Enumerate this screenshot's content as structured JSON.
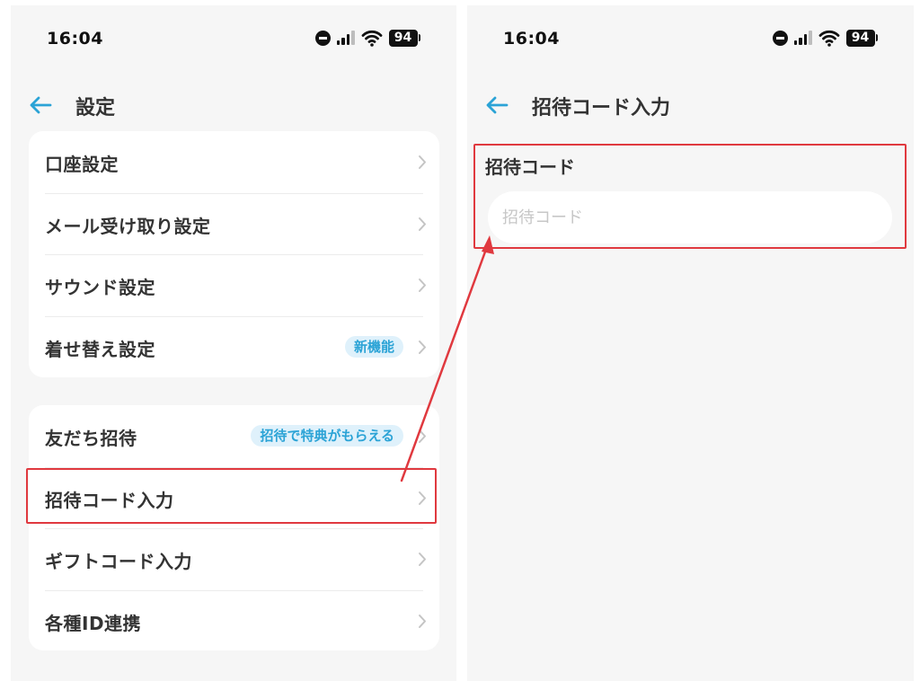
{
  "left_screen": {
    "status_bar": {
      "time": "16:04",
      "battery": "94"
    },
    "header": {
      "title": "設定"
    },
    "settings_group_1": [
      {
        "label": "口座設定"
      },
      {
        "label": "メール受け取り設定"
      },
      {
        "label": "サウンド設定"
      },
      {
        "label": "着せ替え設定",
        "badge": "新機能"
      }
    ],
    "settings_group_2": [
      {
        "label": "友だち招待",
        "badge": "招待で特典がもらえる"
      },
      {
        "label": "招待コード入力"
      },
      {
        "label": "ギフトコード入力"
      },
      {
        "label": "各種ID連携"
      }
    ]
  },
  "right_screen": {
    "status_bar": {
      "time": "16:04",
      "battery": "94"
    },
    "header": {
      "title": "招待コード入力"
    },
    "invite_code": {
      "label": "招待コード",
      "placeholder": "招待コード",
      "value": ""
    }
  },
  "colors": {
    "accent": "#2ba3d6",
    "badge_bg": "#dff1fb",
    "annotation": "#e0393f",
    "background": "#f6f6f6"
  },
  "icons": [
    "back-arrow-icon",
    "chevron-right-icon",
    "do-not-disturb-icon",
    "signal-icon",
    "wifi-icon",
    "battery-icon"
  ]
}
